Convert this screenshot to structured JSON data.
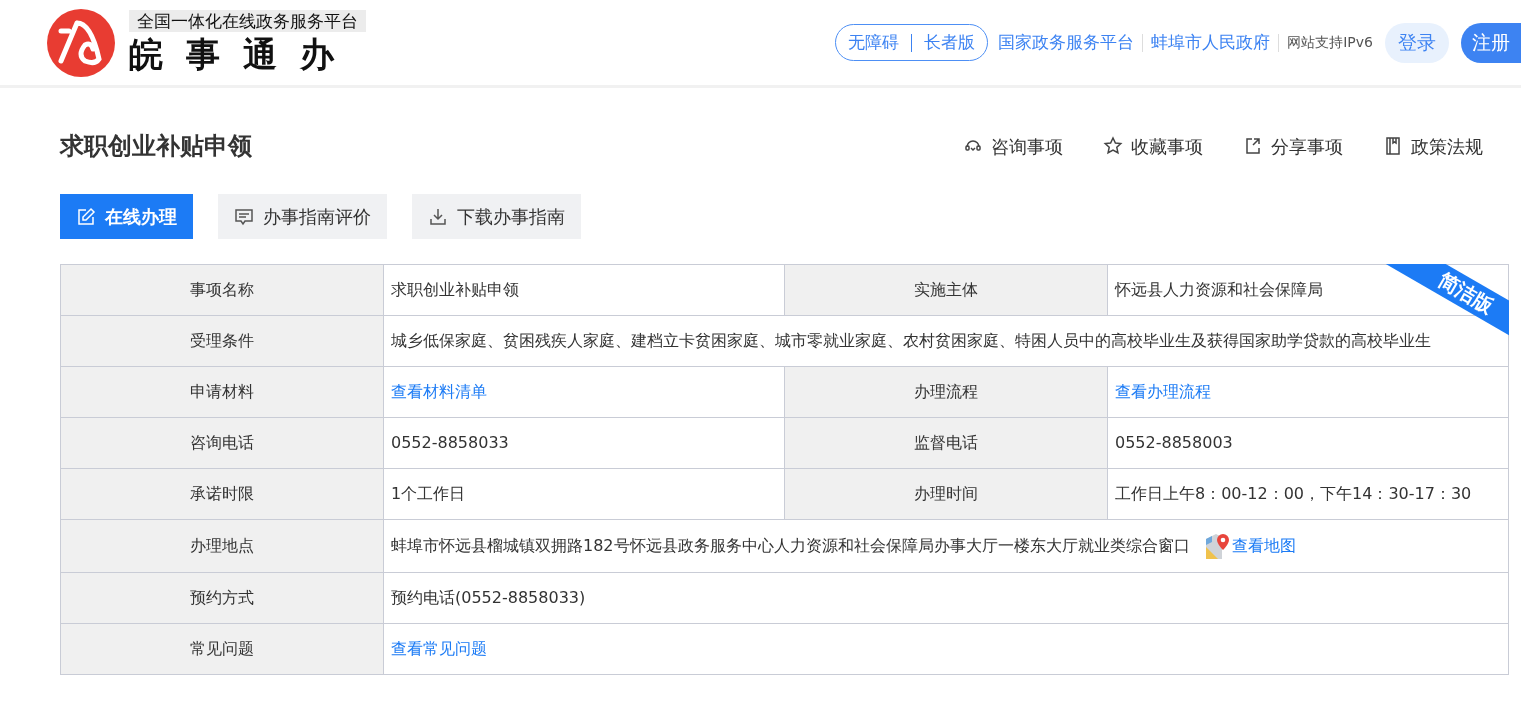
{
  "header": {
    "subtitle": "全国一体化在线政务服务平台",
    "brand": "皖事通办",
    "access_links": [
      "无障碍",
      "长者版"
    ],
    "links": [
      {
        "text": "国家政务服务平台",
        "kind": "link"
      },
      {
        "text": "蚌埠市人民政府",
        "kind": "link"
      },
      {
        "text": "网站支持IPv6",
        "kind": "note"
      }
    ],
    "login": "登录",
    "register": "注册"
  },
  "page": {
    "title": "求职创业补贴申领",
    "actions": [
      {
        "text": "咨询事项",
        "kind": "consult"
      },
      {
        "text": "收藏事项",
        "kind": "star"
      },
      {
        "text": "分享事项",
        "kind": "share"
      },
      {
        "text": "政策法规",
        "kind": "book"
      }
    ],
    "buttons": [
      {
        "text": "在线办理",
        "kind": "edit",
        "primary": true
      },
      {
        "text": "办事指南评价",
        "kind": "comment",
        "primary": false
      },
      {
        "text": "下载办事指南",
        "kind": "download",
        "primary": false
      }
    ]
  },
  "table": {
    "ribbon": "简洁版",
    "rows": [
      {
        "cells": [
          {
            "kind": "label",
            "text": "事项名称"
          },
          {
            "kind": "text",
            "text": "求职创业补贴申领"
          },
          {
            "kind": "label",
            "text": "实施主体"
          },
          {
            "kind": "text",
            "text": "怀远县人力资源和社会保障局"
          }
        ]
      },
      {
        "cells": [
          {
            "kind": "label",
            "text": "受理条件"
          },
          {
            "kind": "text",
            "text": "城乡低保家庭、贫困残疾人家庭、建档立卡贫困家庭、城市零就业家庭、农村贫困家庭、特困人员中的高校毕业生及获得国家助学贷款的高校毕业生"
          }
        ]
      },
      {
        "cells": [
          {
            "kind": "label",
            "text": "申请材料"
          },
          {
            "kind": "link",
            "text": "查看材料清单"
          },
          {
            "kind": "label",
            "text": "办理流程"
          },
          {
            "kind": "link",
            "text": "查看办理流程"
          }
        ]
      },
      {
        "cells": [
          {
            "kind": "label",
            "text": "咨询电话"
          },
          {
            "kind": "text",
            "text": "0552-8858033"
          },
          {
            "kind": "label",
            "text": "监督电话"
          },
          {
            "kind": "text",
            "text": "0552-8858003"
          }
        ]
      },
      {
        "cells": [
          {
            "kind": "label",
            "text": "承诺时限"
          },
          {
            "kind": "text",
            "text": "1个工作日"
          },
          {
            "kind": "label",
            "text": "办理时间"
          },
          {
            "kind": "text",
            "text": "工作日上午8：00-12：00，下午14：30-17：30"
          }
        ]
      },
      {
        "cells": [
          {
            "kind": "label",
            "text": "办理地点"
          },
          {
            "kind": "address",
            "text": "蚌埠市怀远县榴城镇双拥路182号怀远县政务服务中心人力资源和社会保障局办事大厅一楼东大厅就业类综合窗口",
            "link": "查看地图"
          }
        ]
      },
      {
        "cells": [
          {
            "kind": "label",
            "text": "预约方式"
          },
          {
            "kind": "text",
            "text": "预约电话(0552-8858033)"
          }
        ]
      },
      {
        "cells": [
          {
            "kind": "label",
            "text": "常见问题"
          },
          {
            "kind": "link",
            "text": "查看常见问题"
          }
        ]
      }
    ]
  }
}
